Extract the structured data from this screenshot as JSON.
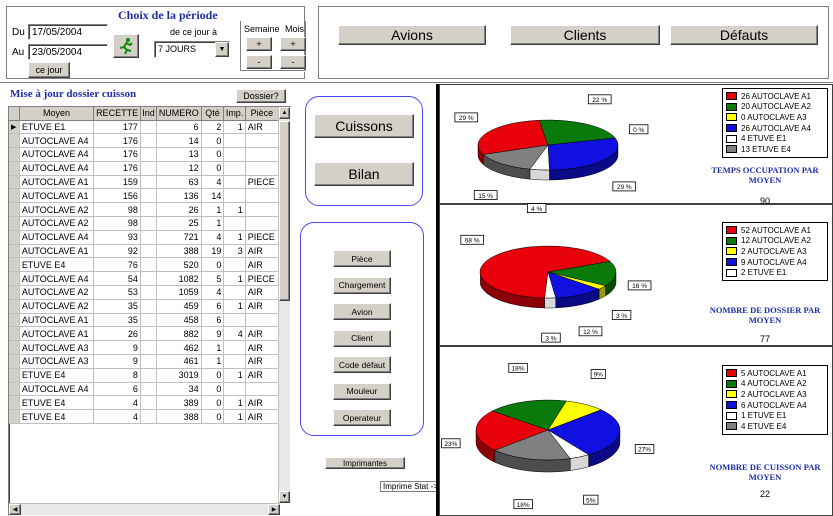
{
  "period": {
    "title": "Choix de la période",
    "du_label": "Du",
    "du_value": "17/05/2004",
    "au_label": "Au",
    "au_value": "23/05/2004",
    "ce_jour": "ce jour",
    "de_ce_jour_label": "de ce jour à",
    "jours_value": "7 JOURS",
    "semaine_label": "Semaine",
    "mois_label": "Mois",
    "plus": "+",
    "minus": "-"
  },
  "topnav": {
    "avions": "Avions",
    "clients": "Clients",
    "defauts": "Défauts"
  },
  "dossier": {
    "title": "Mise à jour dossier cuisson",
    "dossier_button": "Dossier?",
    "columns": [
      "Moyen",
      "RECETTE",
      "Ind",
      "NUMERO",
      "Qté",
      "Imp.",
      "Pièce"
    ],
    "rows": [
      [
        "ETUVE E1",
        "177",
        "",
        "6",
        "2",
        "1",
        "AIR"
      ],
      [
        "AUTOCLAVE A4",
        "176",
        "",
        "14",
        "0",
        "",
        ""
      ],
      [
        "AUTOCLAVE A4",
        "176",
        "",
        "13",
        "0",
        "",
        ""
      ],
      [
        "AUTOCLAVE A4",
        "176",
        "",
        "12",
        "0",
        "",
        ""
      ],
      [
        "AUTOCLAVE A1",
        "159",
        "",
        "63",
        "4",
        "",
        "PIECE"
      ],
      [
        "AUTOCLAVE A1",
        "156",
        "",
        "136",
        "14",
        "",
        ""
      ],
      [
        "AUTOCLAVE A2",
        "98",
        "",
        "26",
        "1",
        "1",
        ""
      ],
      [
        "AUTOCLAVE A2",
        "98",
        "",
        "25",
        "1",
        "",
        ""
      ],
      [
        "AUTOCLAVE A4",
        "93",
        "",
        "721",
        "4",
        "1",
        "PIECE"
      ],
      [
        "AUTOCLAVE A1",
        "92",
        "",
        "388",
        "19",
        "3",
        "AIR"
      ],
      [
        "ETUVE E4",
        "76",
        "",
        "520",
        "0",
        "",
        "AIR"
      ],
      [
        "AUTOCLAVE A4",
        "54",
        "",
        "1082",
        "5",
        "1",
        "PIECE"
      ],
      [
        "AUTOCLAVE A2",
        "53",
        "",
        "1059",
        "4",
        "",
        "AIR"
      ],
      [
        "AUTOCLAVE A2",
        "35",
        "",
        "459",
        "6",
        "1",
        "AIR"
      ],
      [
        "AUTOCLAVE A1",
        "35",
        "",
        "458",
        "6",
        "",
        ""
      ],
      [
        "AUTOCLAVE A1",
        "26",
        "",
        "882",
        "9",
        "4",
        "AIR"
      ],
      [
        "AUTOCLAVE A3",
        "9",
        "",
        "462",
        "1",
        "",
        "AIR"
      ],
      [
        "AUTOCLAVE A3",
        "9",
        "",
        "461",
        "1",
        "",
        "AIR"
      ],
      [
        "ETUVE E4",
        "8",
        "",
        "3019",
        "0",
        "1",
        "AIR"
      ],
      [
        "AUTOCLAVE A4",
        "6",
        "",
        "34",
        "0",
        "",
        ""
      ],
      [
        "ETUVE E4",
        "4",
        "",
        "389",
        "0",
        "1",
        "AIR"
      ],
      [
        "ETUVE E4",
        "4",
        "",
        "388",
        "0",
        "1",
        "AIR"
      ]
    ]
  },
  "middle": {
    "cuissons": "Cuissons",
    "bilan": "Bilan",
    "buttons": [
      "Pièce",
      "Chargement",
      "Avion",
      "Client",
      "Code défaut",
      "Mouleur",
      "Operateur"
    ],
    "imprimantes": "Imprimantes",
    "imprime_stat": "Imprime Stat ->"
  },
  "colors": {
    "A1": "#e8000b",
    "A2": "#0a7a0a",
    "A3": "#ffff00",
    "A4": "#1010e0",
    "E1": "#ffffff",
    "E4": "#808080"
  },
  "chart_data": [
    {
      "type": "pie",
      "title": "TEMPS OCCUPATION PAR MOYEN",
      "total": "90",
      "legend": [
        "26 AUTOCLAVE A1",
        "20 AUTOCLAVE A2",
        "0 AUTOCLAVE A3",
        "26 AUTOCLAVE A4",
        "4 ETUVE E1",
        "13 ETUVE E4"
      ],
      "slices": [
        {
          "name": "AUTOCLAVE A1",
          "value": 26,
          "color": "#e8000b",
          "label": "29 %"
        },
        {
          "name": "AUTOCLAVE A2",
          "value": 20,
          "color": "#0a7a0a",
          "label": "22 %"
        },
        {
          "name": "AUTOCLAVE A3",
          "value": 0,
          "color": "#ffff00",
          "label": "0 %"
        },
        {
          "name": "AUTOCLAVE A4",
          "value": 26,
          "color": "#1010e0",
          "label": "29 %"
        },
        {
          "name": "ETUVE E1",
          "value": 4,
          "color": "#ffffff",
          "label": "4 %"
        },
        {
          "name": "ETUVE E4",
          "value": 13,
          "color": "#808080",
          "label": "15 %"
        }
      ]
    },
    {
      "type": "pie",
      "title": "NOMBRE DE DOSSIER PAR MOYEN",
      "total": "77",
      "legend": [
        "52 AUTOCLAVE A1",
        "12 AUTOCLAVE A2",
        "2 AUTOCLAVE A3",
        "9 AUTOCLAVE A4",
        "2 ETUVE E1"
      ],
      "slices": [
        {
          "name": "AUTOCLAVE A1",
          "value": 52,
          "color": "#e8000b",
          "label": "68 %"
        },
        {
          "name": "AUTOCLAVE A2",
          "value": 12,
          "color": "#0a7a0a",
          "label": "16 %"
        },
        {
          "name": "AUTOCLAVE A3",
          "value": 2,
          "color": "#ffff00",
          "label": "3 %"
        },
        {
          "name": "AUTOCLAVE A4",
          "value": 9,
          "color": "#1010e0",
          "label": "12 %"
        },
        {
          "name": "ETUVE E1",
          "value": 2,
          "color": "#ffffff",
          "label": "3 %"
        }
      ]
    },
    {
      "type": "pie",
      "title": "NOMBRE DE CUISSON PAR MOYEN",
      "total": "22",
      "legend": [
        "5 AUTOCLAVE A1",
        "4 AUTOCLAVE A2",
        "2 AUTOCLAVE A3",
        "6 AUTOCLAVE A4",
        "1 ETUVE E1",
        "4 ETUVE E4"
      ],
      "slices": [
        {
          "name": "AUTOCLAVE A1",
          "value": 5,
          "color": "#e8000b",
          "label": "23%"
        },
        {
          "name": "AUTOCLAVE A2",
          "value": 4,
          "color": "#0a7a0a",
          "label": "18%"
        },
        {
          "name": "AUTOCLAVE A3",
          "value": 2,
          "color": "#ffff00",
          "label": "9%"
        },
        {
          "name": "AUTOCLAVE A4",
          "value": 6,
          "color": "#1010e0",
          "label": "27%"
        },
        {
          "name": "ETUVE E1",
          "value": 1,
          "color": "#ffffff",
          "label": "5%"
        },
        {
          "name": "ETUVE E4",
          "value": 4,
          "color": "#808080",
          "label": "18%"
        }
      ]
    }
  ]
}
